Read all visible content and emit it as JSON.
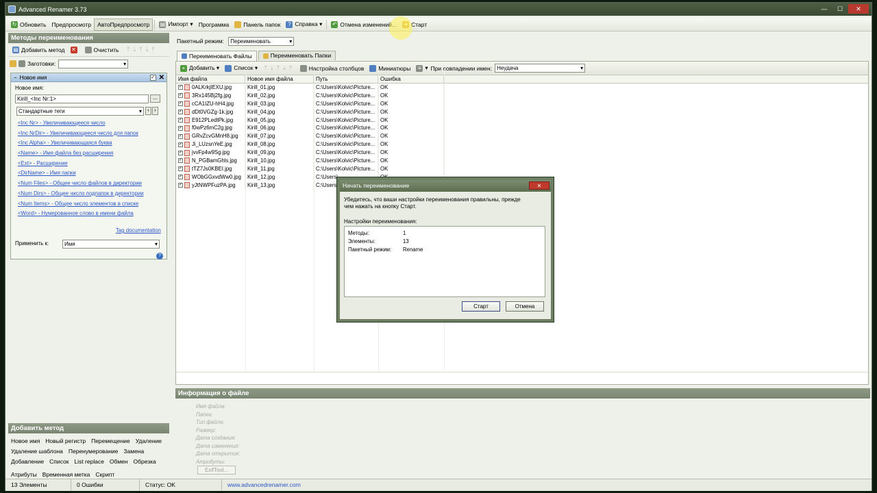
{
  "window": {
    "title": "Advanced Renamer 3.73"
  },
  "toolbar": {
    "refresh": "Обновить",
    "preview": "Предпросмотр",
    "autopreview": "АвтоПредпросмотр",
    "import": "Импорт ▾",
    "program": "Программа",
    "folder_panel": "Панель папок",
    "help": "Справка ▾",
    "undo": "Отмена изменений...",
    "start": "Старт"
  },
  "left": {
    "header": "Методы переименования",
    "add_method": "Добавить метод",
    "clear": "Очистить",
    "presets_label": "Заготовки:",
    "presets_value": "",
    "method": {
      "title": "Новое имя",
      "checked": "✓",
      "new_name_label": "Новое имя:",
      "new_name_value": "Kirill_<Inc Nr:1>",
      "more": "...",
      "tags_select": "Стандартные теги",
      "tags": [
        "<Inc Nr> - Увеличивающееся число",
        "<Inc NrDir> - Увеличивающееся число для папок",
        "<Inc Alpha> - Увеличивающаяся буква",
        "<Name> - Имя файла без расширения",
        "<Ext> - Расширение",
        "<DirName> - Имя папки",
        "<Num Files> - Общее число файлов в директории",
        "<Num Dirs> - Общее число подпапок в директории",
        "<Num Items> - Общее число элементов в списке",
        "<Word> - Нумерованное слово в имени файла"
      ],
      "tag_doc": "Tag documentation",
      "apply_label": "Применить к:",
      "apply_value": "Имя"
    },
    "add_header": "Добавить метод",
    "add_rows": [
      [
        "Новое имя",
        "Новый регистр",
        "Перемещение",
        "Удаление"
      ],
      [
        "Удаление шаблона",
        "Перенумерование",
        "Замена"
      ],
      [
        "Добавление",
        "Список",
        "List replace",
        "Обмен",
        "Обрезка"
      ],
      [
        "Атрибуты",
        "Временная метка",
        "Скрипт"
      ]
    ]
  },
  "right": {
    "batch_label": "Пакетный режим:",
    "batch_value": "Переименовать",
    "tabs": [
      "Переименовать Файлы",
      "Переименовать Папки"
    ],
    "grid_toolbar": {
      "add": "Добавить ▾",
      "list": "Список ▾",
      "columns": "Настройка столбцов",
      "thumbs": "Миниатюры",
      "collision_label": "При совпадении имен:",
      "collision_value": "Неудача"
    },
    "columns": [
      "Имя файла",
      "Новое имя файла",
      "Путь",
      "Ошибка"
    ],
    "rows": [
      [
        "0ALKrkjIEXU.jpg",
        "Kirill_01.jpg",
        "C:\\Users\\Kolvic\\Picture...",
        "OK"
      ],
      [
        "3Rx145Bj2fg.jpg",
        "Kirill_02.jpg",
        "C:\\Users\\Kolvic\\Picture...",
        "OK"
      ],
      [
        "cCA1IZU-hH4.jpg",
        "Kirill_03.jpg",
        "C:\\Users\\Kolvic\\Picture...",
        "OK"
      ],
      [
        "dDt0VGZg-1k.jpg",
        "Kirill_04.jpg",
        "C:\\Users\\Kolvic\\Picture...",
        "OK"
      ],
      [
        "E912PLedtPk.jpg",
        "Kirill_05.jpg",
        "C:\\Users\\Kolvic\\Picture...",
        "OK"
      ],
      [
        "f0wPz6mC2g.jpg",
        "Kirill_06.jpg",
        "C:\\Users\\Kolvic\\Picture...",
        "OK"
      ],
      [
        "GRvZcvGMnH8.jpg",
        "Kirill_07.jpg",
        "C:\\Users\\Kolvic\\Picture...",
        "OK"
      ],
      [
        "Ji_LUzsnYeE.jpg",
        "Kirill_08.jpg",
        "C:\\Users\\Kolvic\\Picture...",
        "OK"
      ],
      [
        "jvvFp4w9Sg.jpg",
        "Kirill_09.jpg",
        "C:\\Users\\Kolvic\\Picture...",
        "OK"
      ],
      [
        "N_PGBamGhls.jpg",
        "Kirill_10.jpg",
        "C:\\Users\\Kolvic\\Picture...",
        "OK"
      ],
      [
        "tTZ7Js0KBEI.jpg",
        "Kirill_11.jpg",
        "C:\\Users\\Kolvic\\Picture...",
        "OK"
      ],
      [
        "WObGGxvdWw0.jpg",
        "Kirill_12.jpg",
        "C:\\Users\\",
        "OK"
      ],
      [
        "yJtNWPFuzPA.jpg",
        "Kirill_13.jpg",
        "C:\\Users\\",
        "OK"
      ]
    ]
  },
  "info": {
    "header": "Информация о файле",
    "labels": [
      "Имя файла:",
      "Папка:",
      "Тип файла:",
      "Размер:",
      "Дата создания:",
      "Дата изменения:",
      "Дата открытия:",
      "Атрибуты:"
    ],
    "exif": "ExifTool..."
  },
  "status": {
    "items": "13 Элементы",
    "errors": "0 Ошибки",
    "state": "Статус: OK",
    "link": "www.advancedrenamer.com"
  },
  "dialog": {
    "title": "Начать переименование",
    "message": "Убедитесь, что ваши настройки переименования правильны, прежде чем нажать на кнопку Старт.",
    "settings_label": "Настройки переименования:",
    "rows": [
      [
        "Методы:",
        "1"
      ],
      [
        "Элементы:",
        "13"
      ],
      [
        "Пакетный режим:",
        "Rename"
      ]
    ],
    "start": "Старт",
    "cancel": "Отмена",
    "close": "✕"
  }
}
